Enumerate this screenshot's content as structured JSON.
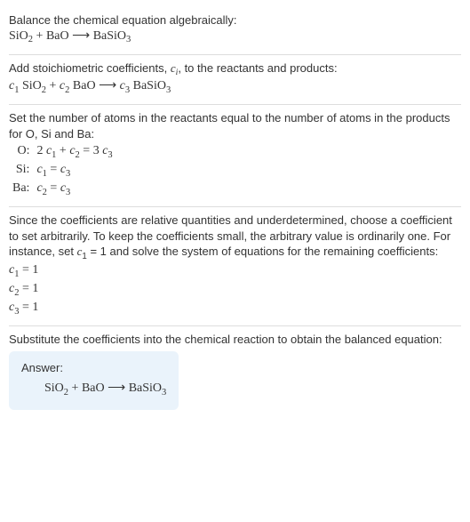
{
  "sec1": {
    "title": "Balance the chemical equation algebraically:",
    "eq_a": "SiO",
    "eq_a_sub": "2",
    "eq_plus1": " + BaO ",
    "eq_arrow": "⟶",
    "eq_b": " BaSiO",
    "eq_b_sub": "3"
  },
  "sec2": {
    "line1a": "Add stoichiometric coefficients, ",
    "line1b": "c",
    "line1b_sub": "i",
    "line1c": ", to the reactants and products:",
    "eq_c1": "c",
    "eq_c1_sub": "1",
    "eq_sio": " SiO",
    "eq_sio_sub": "2",
    "eq_plus": " + ",
    "eq_c2": "c",
    "eq_c2_sub": "2",
    "eq_bao": " BaO ",
    "eq_arrow": "⟶",
    "eq_sp": " ",
    "eq_c3": "c",
    "eq_c3_sub": "3",
    "eq_basio": " BaSiO",
    "eq_basio_sub": "3"
  },
  "sec3": {
    "intro": "Set the number of atoms in the reactants equal to the number of atoms in the products for O, Si and Ba:",
    "rows": [
      {
        "label": "O:",
        "lhs_a": "2 ",
        "c1": "c",
        "c1s": "1",
        "plus": " + ",
        "c2": "c",
        "c2s": "2",
        "eq": " = 3 ",
        "c3": "c",
        "c3s": "3"
      },
      {
        "label": "Si:",
        "lhs_a": "",
        "c1": "c",
        "c1s": "1",
        "plus": "",
        "c2": "",
        "c2s": "",
        "eq": " = ",
        "c3": "c",
        "c3s": "3"
      },
      {
        "label": "Ba:",
        "lhs_a": "",
        "c1": "c",
        "c1s": "2",
        "plus": "",
        "c2": "",
        "c2s": "",
        "eq": " = ",
        "c3": "c",
        "c3s": "3"
      }
    ]
  },
  "sec4": {
    "para_a": "Since the coefficients are relative quantities and underdetermined, choose a coefficient to set arbitrarily. To keep the coefficients small, the arbitrary value is ordinarily one. For instance, set ",
    "cv": "c",
    "cv_sub": "1",
    "para_b": " = 1 and solve the system of equations for the remaining coefficients:",
    "lines": [
      {
        "c": "c",
        "cs": "1",
        "rest": " = 1"
      },
      {
        "c": "c",
        "cs": "2",
        "rest": " = 1"
      },
      {
        "c": "c",
        "cs": "3",
        "rest": " = 1"
      }
    ]
  },
  "sec5": {
    "intro": "Substitute the coefficients into the chemical reaction to obtain the balanced equation:",
    "answer_label": "Answer:",
    "eq_a": "SiO",
    "eq_a_sub": "2",
    "eq_plus": " + BaO ",
    "eq_arrow": "⟶",
    "eq_b": " BaSiO",
    "eq_b_sub": "3"
  }
}
